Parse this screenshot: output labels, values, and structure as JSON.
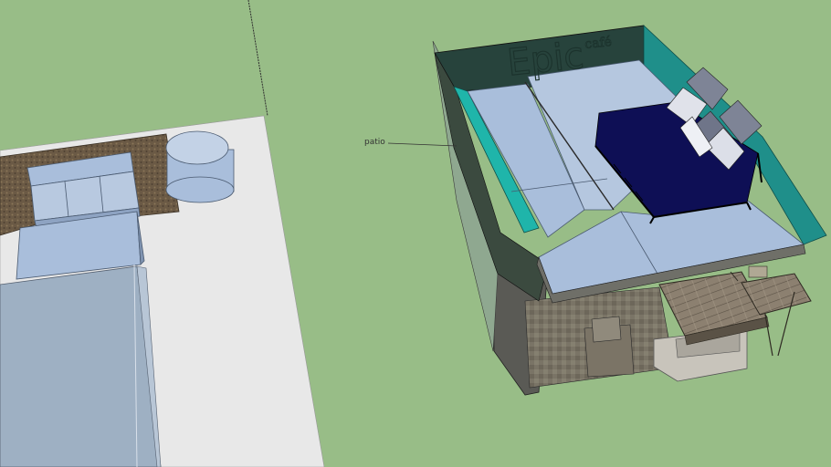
{
  "viewport": {
    "background_color": "#98bd87"
  },
  "annotations": [
    {
      "label": "patio"
    }
  ],
  "sign": {
    "text": "Epic",
    "prefix": "café"
  },
  "colors": {
    "ground": "#98bd87",
    "pavement": "#e8e8e8",
    "roof_surface": "#a9bedb",
    "teal_wall": "#1f8f8a",
    "dark_wall": "#27433c",
    "bed_navy": "#0e0f55",
    "pillow_gray": "#7e8496",
    "wood_deck": "#8c8070",
    "stone_planter": "#6b5a45"
  },
  "objects": [
    "patio-sofa",
    "round-table",
    "stone-planter",
    "tall-block",
    "building-roof",
    "bed",
    "deck",
    "stairs"
  ]
}
